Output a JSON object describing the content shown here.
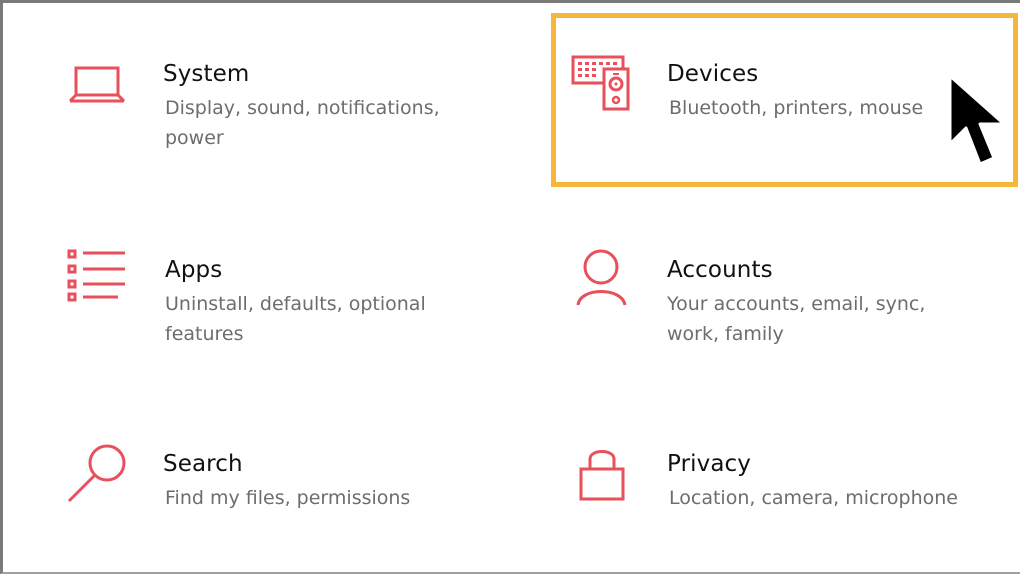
{
  "settings": {
    "tiles": [
      {
        "title": "System",
        "desc": "Display, sound, notifications, power",
        "icon": "laptop-icon"
      },
      {
        "title": "Devices",
        "desc": "Bluetooth, printers, mouse",
        "icon": "devices-icon"
      },
      {
        "title": "Apps",
        "desc": "Uninstall, defaults, optional features",
        "icon": "apps-list-icon"
      },
      {
        "title": "Accounts",
        "desc": "Your accounts, email, sync, work, family",
        "icon": "person-icon"
      },
      {
        "title": "Search",
        "desc": "Find my files, permissions",
        "icon": "search-icon"
      },
      {
        "title": "Privacy",
        "desc": "Location, camera, microphone",
        "icon": "lock-icon"
      }
    ]
  },
  "colors": {
    "icon": "#e8505b",
    "highlight": "#f4b73a",
    "title": "#111111",
    "description": "#6d6d6d"
  },
  "annotations": {
    "highlighted_tile": "Devices",
    "cursor_icon": "arrow-cursor-icon"
  }
}
